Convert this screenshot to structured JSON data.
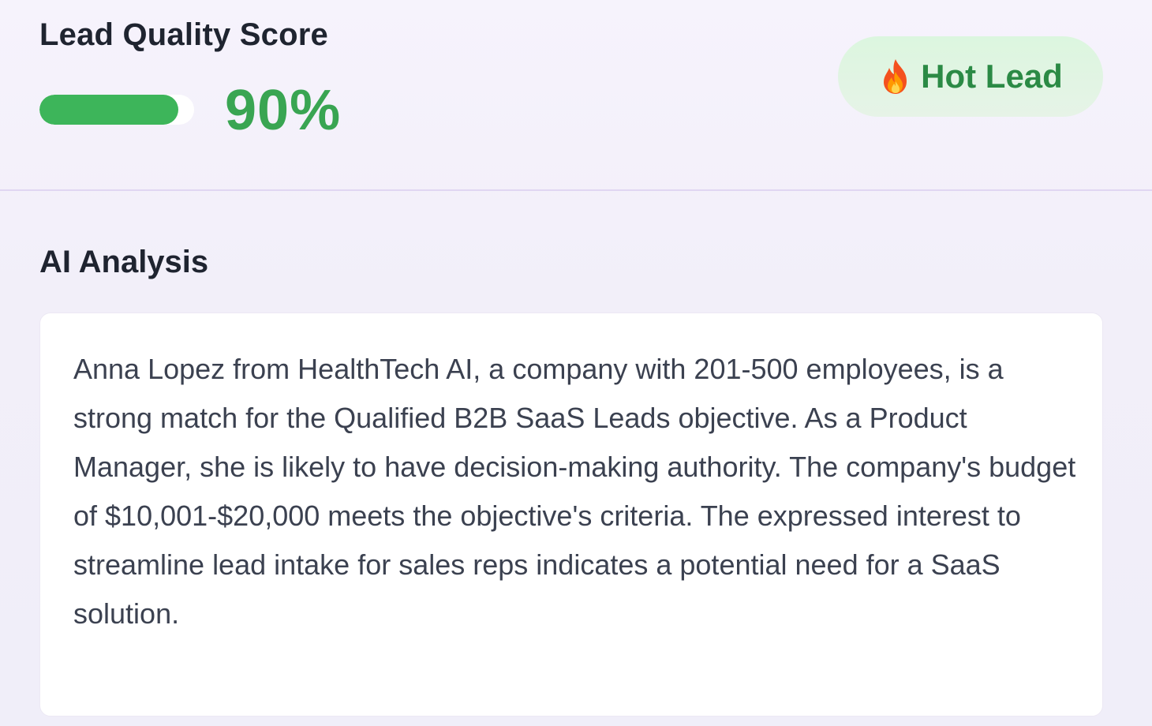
{
  "score": {
    "title": "Lead Quality Score",
    "value_label": "90%",
    "percent": 90,
    "fill_color": "#3db55a"
  },
  "badge": {
    "icon": "fire-icon",
    "label": "Hot Lead"
  },
  "analysis": {
    "title": "AI Analysis",
    "text": "Anna Lopez from HealthTech AI, a company with 201-500 employees, is a strong match for the Qualified B2B SaaS Leads objective. As a Product Manager, she is likely to have decision-making authority. The company's budget of $10,001-$20,000 meets the objective's criteria. The expressed interest to streamline lead intake for sales reps indicates a potential need for a SaaS solution."
  }
}
